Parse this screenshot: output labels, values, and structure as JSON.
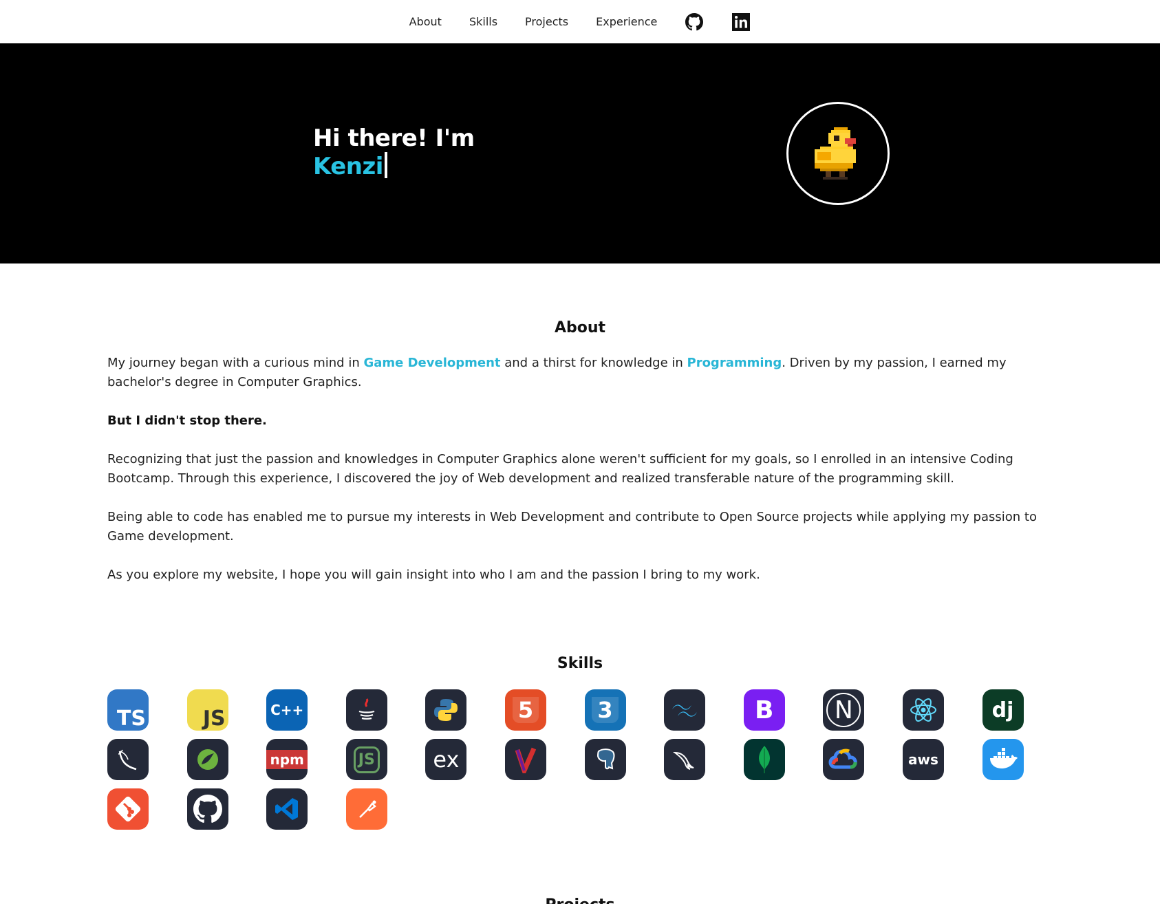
{
  "nav": {
    "items": [
      "About",
      "Skills",
      "Projects",
      "Experience"
    ],
    "github_icon": "github-icon",
    "linkedin_icon": "linkedin-icon"
  },
  "hero": {
    "greeting": "Hi there! I'm",
    "name": "Kenzi",
    "avatar_icon": "pixel-duck-avatar"
  },
  "about": {
    "title": "About",
    "p1_a": "My journey began with a curious mind in ",
    "p1_hl1": "Game Development",
    "p1_b": " and a thirst for knowledge in ",
    "p1_hl2": "Programming",
    "p1_c": ". Driven by my passion, I earned my bachelor's degree in Computer Graphics.",
    "p2": "But I didn't stop there.",
    "p3": "Recognizing that just the passion and knowledges in Computer Graphics alone weren't sufficient for my goals, so I enrolled in an intensive Coding Bootcamp. Through this experience, I discovered the joy of Web development and realized transferable nature of the programming skill.",
    "p4": "Being able to code has enabled me to pursue my interests in Web Development and contribute to Open Source projects while applying my passion to Game development.",
    "p5": "As you explore my website, I hope you will gain insight into who I am and the passion I bring to my work."
  },
  "skills": {
    "title": "Skills",
    "icons": [
      {
        "name": "typescript-icon",
        "label": "TS",
        "bg": "#3178c6",
        "fg": "#ffffff"
      },
      {
        "name": "javascript-icon",
        "label": "JS",
        "bg": "#f0db4f",
        "fg": "#323330"
      },
      {
        "name": "cplusplus-icon",
        "label": "C++",
        "bg": "#0b64b4",
        "fg": "#ffffff"
      },
      {
        "name": "java-icon",
        "label": "",
        "bg": "#242938",
        "fg": "#ea2d2e"
      },
      {
        "name": "python-icon",
        "label": "",
        "bg": "#242938",
        "fg": "#3776ab"
      },
      {
        "name": "html5-icon",
        "label": "5",
        "bg": "#e44d26",
        "fg": "#ffffff"
      },
      {
        "name": "css3-icon",
        "label": "3",
        "bg": "#1572b6",
        "fg": "#ffffff"
      },
      {
        "name": "tailwind-icon",
        "label": "",
        "bg": "#242938",
        "fg": "#38bdf8"
      },
      {
        "name": "bootstrap-icon",
        "label": "B",
        "bg": "#7a1ff2",
        "fg": "#ffffff"
      },
      {
        "name": "nextjs-icon",
        "label": "N",
        "bg": "#242938",
        "fg": "#ffffff"
      },
      {
        "name": "react-icon",
        "label": "",
        "bg": "#242938",
        "fg": "#61dafb"
      },
      {
        "name": "django-icon",
        "label": "dj",
        "bg": "#0c3c26",
        "fg": "#ffffff"
      },
      {
        "name": "flask-icon",
        "label": "",
        "bg": "#242938",
        "fg": "#ffffff"
      },
      {
        "name": "spring-icon",
        "label": "",
        "bg": "#242938",
        "fg": "#6db33f"
      },
      {
        "name": "npm-icon",
        "label": "npm",
        "bg": "#242938",
        "fg": "#cb3837"
      },
      {
        "name": "nodejs-icon",
        "label": "JS",
        "bg": "#242938",
        "fg": "#68a063"
      },
      {
        "name": "express-icon",
        "label": "ex",
        "bg": "#242938",
        "fg": "#ffffff"
      },
      {
        "name": "maven-icon",
        "label": "",
        "bg": "#242938",
        "fg": "#d32f2f"
      },
      {
        "name": "postgresql-icon",
        "label": "",
        "bg": "#242938",
        "fg": "#ffffff"
      },
      {
        "name": "mysql-icon",
        "label": "",
        "bg": "#242938",
        "fg": "#ffffff"
      },
      {
        "name": "mongodb-icon",
        "label": "",
        "bg": "#023430",
        "fg": "#13aa52"
      },
      {
        "name": "google-cloud-icon",
        "label": "",
        "bg": "#242938",
        "fg": "#4285f4"
      },
      {
        "name": "aws-icon",
        "label": "aws",
        "bg": "#242938",
        "fg": "#ffffff"
      },
      {
        "name": "docker-icon",
        "label": "",
        "bg": "#2496ed",
        "fg": "#ffffff"
      },
      {
        "name": "git-icon",
        "label": "",
        "bg": "#f05033",
        "fg": "#ffffff"
      },
      {
        "name": "github-icon",
        "label": "",
        "bg": "#242938",
        "fg": "#ffffff"
      },
      {
        "name": "vscode-icon",
        "label": "",
        "bg": "#242938",
        "fg": "#0078d7"
      },
      {
        "name": "postman-icon",
        "label": "",
        "bg": "#ff6c37",
        "fg": "#ffffff"
      }
    ]
  },
  "projects": {
    "title": "Projects"
  }
}
